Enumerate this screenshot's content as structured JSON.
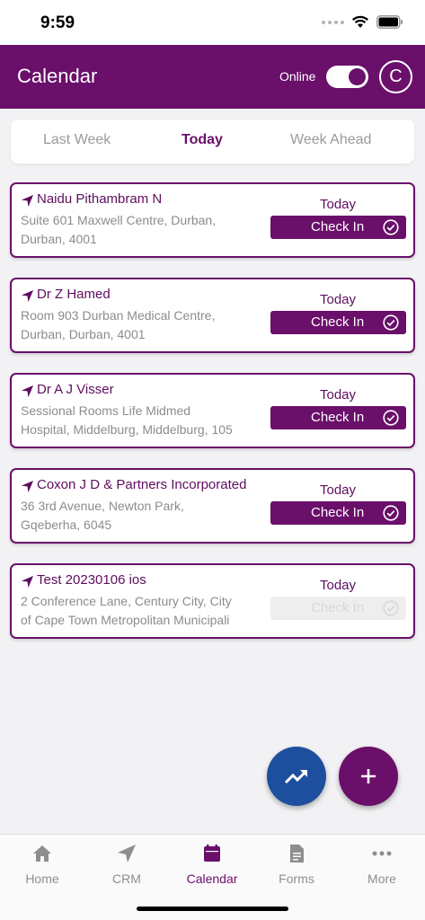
{
  "status_bar": {
    "time": "9:59"
  },
  "header": {
    "title": "Calendar",
    "online_label": "Online",
    "online": true,
    "avatar_initial": "C"
  },
  "tabs": [
    {
      "label": "Last Week",
      "active": false
    },
    {
      "label": "Today",
      "active": true
    },
    {
      "label": "Week Ahead",
      "active": false
    }
  ],
  "visits": [
    {
      "name": "Naidu Pithambram N",
      "address": "Suite 601  Maxwell Centre, Durban,\nDurban, 4001",
      "day": "Today",
      "checkin_label": "Check In",
      "checkin_enabled": true
    },
    {
      "name": "Dr Z Hamed",
      "address": "Room 903  Durban Medical Centre,\nDurban, Durban, 4001",
      "day": "Today",
      "checkin_label": "Check In",
      "checkin_enabled": true
    },
    {
      "name": "Dr A J Visser",
      "address": "Sessional Rooms  Life Midmed\nHospital, Middelburg, Middelburg, 105",
      "day": "Today",
      "checkin_label": "Check In",
      "checkin_enabled": true
    },
    {
      "name": "Coxon J D & Partners Incorporated",
      "address": "36 3rd Avenue, Newton Park,\nGqeberha, 6045",
      "day": "Today",
      "checkin_label": "Check In",
      "checkin_enabled": true
    },
    {
      "name": "Test 20230106 ios",
      "address": "2 Conference Lane, Century City, City\nof Cape Town Metropolitan Municipali",
      "day": "Today",
      "checkin_label": "Check In",
      "checkin_enabled": false
    }
  ],
  "fabs": {
    "stats_icon": "trending-up-icon",
    "add_icon": "plus-icon"
  },
  "bottom_nav": [
    {
      "label": "Home",
      "icon": "home-icon",
      "active": false
    },
    {
      "label": "CRM",
      "icon": "navigation-arrow-icon",
      "active": false
    },
    {
      "label": "Calendar",
      "icon": "calendar-icon",
      "active": true
    },
    {
      "label": "Forms",
      "icon": "document-icon",
      "active": false
    },
    {
      "label": "More",
      "icon": "more-dots-icon",
      "active": false
    }
  ],
  "colors": {
    "brand": "#6a0f6a",
    "fab_stats": "#1e4f9e",
    "muted_text": "#8c8c8c",
    "disabled": "#eeeeee"
  }
}
